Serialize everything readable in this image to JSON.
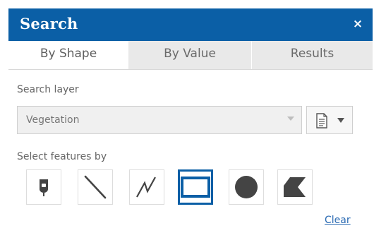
{
  "header": {
    "title": "Search",
    "close_glyph": "×",
    "colors": {
      "background": "#0b5fa6",
      "text": "#ffffff"
    }
  },
  "tabs": [
    {
      "label": "By Shape",
      "active": true
    },
    {
      "label": "By Value",
      "active": false
    },
    {
      "label": "Results",
      "active": false
    }
  ],
  "search_layer": {
    "label": "Search layer",
    "selected_value": "Vegetation",
    "options_icon": "document-icon"
  },
  "select_features": {
    "label": "Select features by",
    "tools": [
      {
        "name": "point-tool",
        "icon": "pushpin-icon",
        "selected": false
      },
      {
        "name": "line-tool",
        "icon": "line-icon",
        "selected": false
      },
      {
        "name": "polyline-tool",
        "icon": "polyline-icon",
        "selected": false
      },
      {
        "name": "extent-tool",
        "icon": "rectangle-icon",
        "selected": true
      },
      {
        "name": "circle-tool",
        "icon": "circle-icon",
        "selected": false
      },
      {
        "name": "polygon-tool",
        "icon": "polygon-icon",
        "selected": false
      }
    ]
  },
  "actions": {
    "clear_label": "Clear"
  }
}
